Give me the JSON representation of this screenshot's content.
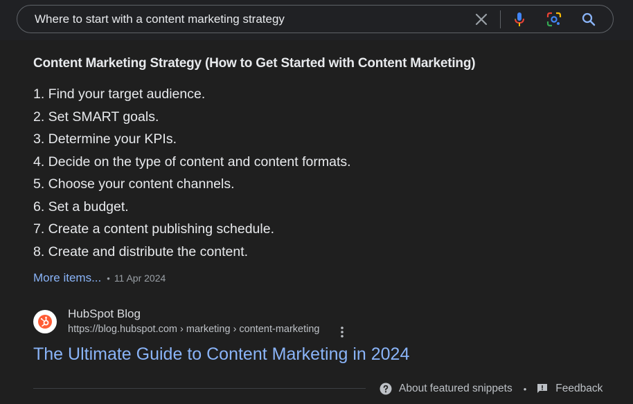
{
  "search": {
    "query": "Where to start with a content marketing strategy",
    "icons": {
      "clear": "close-icon",
      "voice": "microphone-icon",
      "lens": "google-lens-icon",
      "submit": "search-icon"
    }
  },
  "snippet": {
    "title": "Content Marketing Strategy (How to Get Started with Content Marketing)",
    "steps": [
      "1. Find your target audience.",
      "2. Set SMART goals.",
      "3. Determine your KPIs.",
      "4. Decide on the type of content and content formats.",
      "5. Choose your content channels.",
      "6. Set a budget.",
      "7. Create a content publishing schedule.",
      "8. Create and distribute the content."
    ],
    "more_items_label": "More items...",
    "separator": "•",
    "date": "11 Apr 2024"
  },
  "source": {
    "site_name": "HubSpot Blog",
    "url": "https://blog.hubspot.com › marketing › content-marketing",
    "favicon": "hubspot-logo-icon",
    "menu_icon": "more-vert-icon"
  },
  "result": {
    "title": "The Ultimate Guide to Content Marketing in 2024"
  },
  "footer": {
    "about_label": "About featured snippets",
    "separator": "•",
    "feedback_label": "Feedback"
  },
  "colors": {
    "background": "#1f1f1f",
    "text": "#e8eaed",
    "link": "#8ab4f8",
    "muted": "#9aa0a6",
    "hubspot_orange": "#ff5c35"
  }
}
